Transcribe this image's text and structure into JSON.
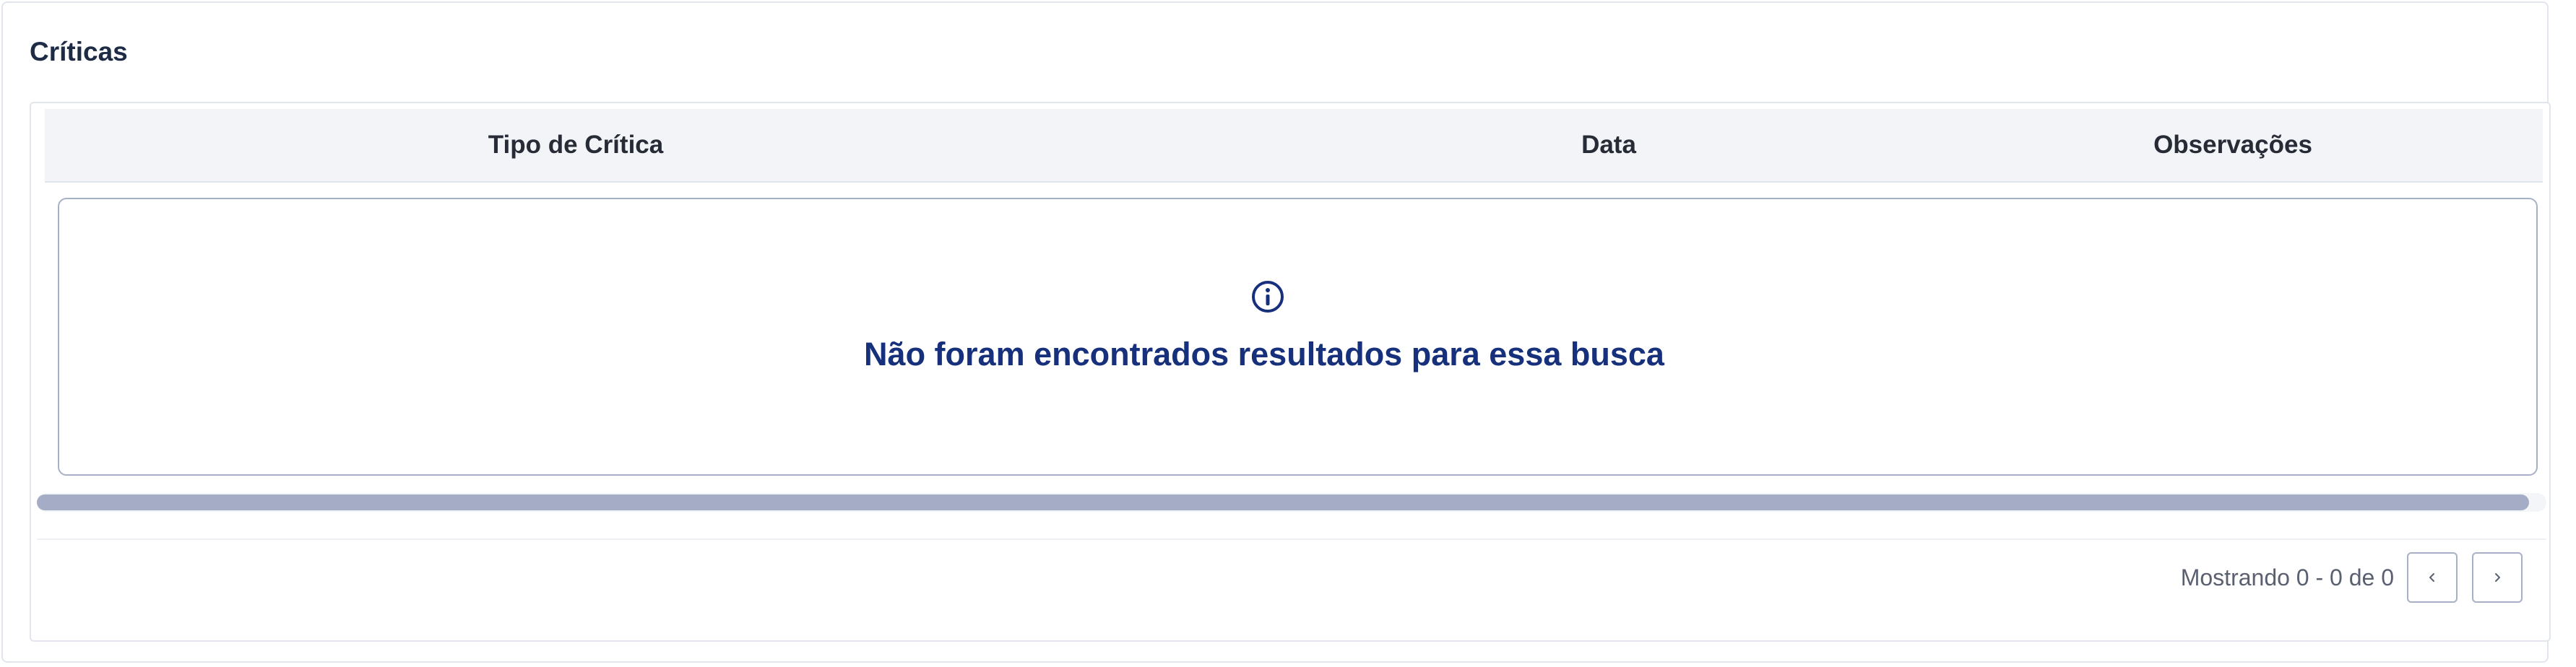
{
  "panel": {
    "title": "Críticas"
  },
  "table": {
    "columns": [
      "Tipo de Crítica",
      "Data",
      "Observações"
    ],
    "rows": [],
    "empty_message": "Não foram encontrados resultados para essa busca"
  },
  "pagination": {
    "info": "Mostrando 0 - 0 de 0",
    "prev_icon": "chevron-left-icon",
    "next_icon": "chevron-right-icon"
  },
  "icons": {
    "empty_state": "info-circle-icon"
  },
  "colors": {
    "empty_message": "#17307b",
    "header_bg": "#f3f4f8",
    "scrollbar_thumb": "#a5adc6"
  }
}
